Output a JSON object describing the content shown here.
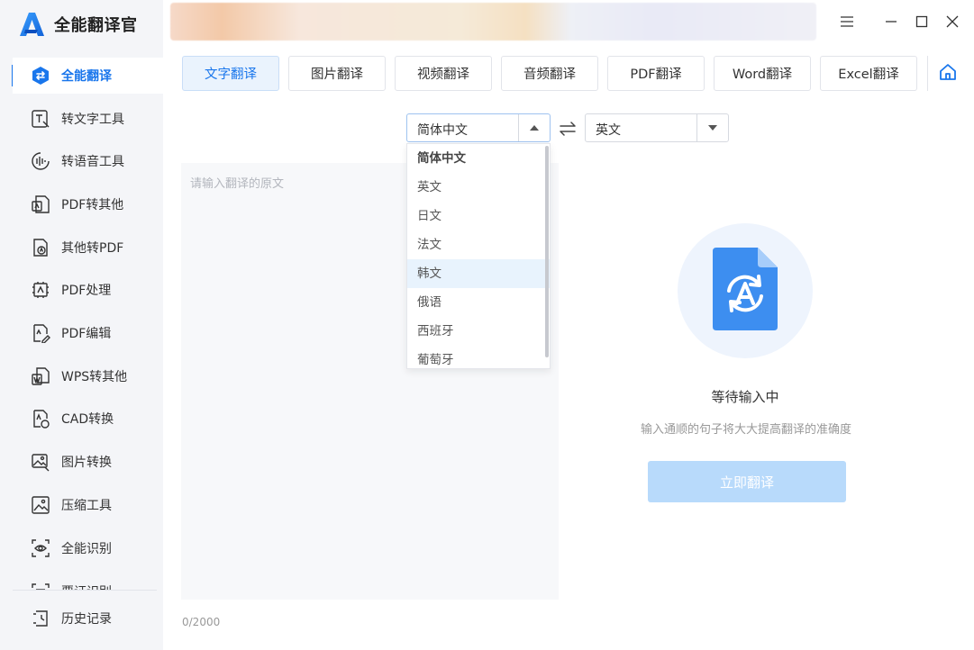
{
  "app": {
    "title": "全能翻译官"
  },
  "sidebar": {
    "items": [
      {
        "label": "全能翻译",
        "icon": "translate-icon",
        "active": true
      },
      {
        "label": "转文字工具",
        "icon": "text-tool-icon"
      },
      {
        "label": "转语音工具",
        "icon": "voice-tool-icon"
      },
      {
        "label": "PDF转其他",
        "icon": "pdf-convert-icon"
      },
      {
        "label": "其他转PDF",
        "icon": "to-pdf-icon"
      },
      {
        "label": "PDF处理",
        "icon": "pdf-process-icon"
      },
      {
        "label": "PDF编辑",
        "icon": "pdf-edit-icon"
      },
      {
        "label": "WPS转其他",
        "icon": "wps-convert-icon"
      },
      {
        "label": "CAD转换",
        "icon": "cad-convert-icon"
      },
      {
        "label": "图片转换",
        "icon": "image-convert-icon"
      },
      {
        "label": "压缩工具",
        "icon": "compress-icon"
      },
      {
        "label": "全能识别",
        "icon": "recognize-icon"
      },
      {
        "label": "票证识别",
        "icon": "ticket-icon"
      }
    ],
    "history": {
      "label": "历史记录",
      "icon": "history-icon"
    }
  },
  "tabs": [
    {
      "label": "文字翻译",
      "active": true
    },
    {
      "label": "图片翻译"
    },
    {
      "label": "视频翻译"
    },
    {
      "label": "音频翻译"
    },
    {
      "label": "PDF翻译"
    },
    {
      "label": "Word翻译"
    },
    {
      "label": "Excel翻译"
    }
  ],
  "source_lang": {
    "value": "简体中文"
  },
  "target_lang": {
    "value": "英文"
  },
  "dropdown": {
    "options": [
      "简体中文",
      "英文",
      "日文",
      "法文",
      "韩文",
      "俄语",
      "西班牙",
      "葡萄牙"
    ],
    "selected": "简体中文",
    "hovered": "韩文"
  },
  "input": {
    "placeholder": "请输入翻译的原文",
    "counter": "0/2000"
  },
  "result": {
    "title": "等待输入中",
    "subtitle": "输入通顺的句子将大大提高翻译的准确度",
    "button": "立即翻译"
  },
  "colors": {
    "accent": "#1976ec",
    "button_disabled": "#b8dafb",
    "sidebar_bg": "#f4f5f8"
  }
}
